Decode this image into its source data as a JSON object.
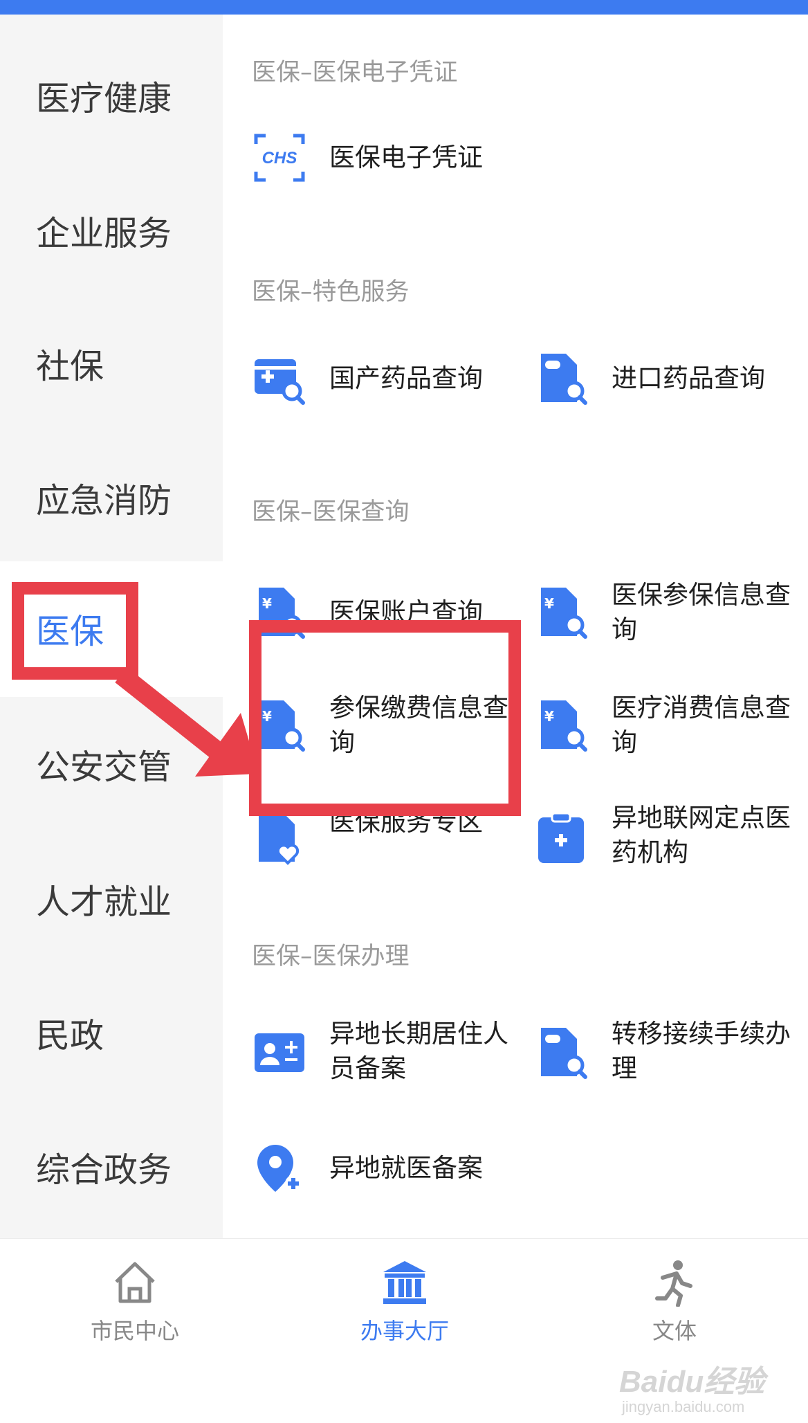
{
  "sidebar": {
    "items": [
      {
        "label": "医疗健康"
      },
      {
        "label": "企业服务"
      },
      {
        "label": "社保"
      },
      {
        "label": "应急消防"
      },
      {
        "label": "医保",
        "active": true
      },
      {
        "label": "公安交管"
      },
      {
        "label": "人才就业"
      },
      {
        "label": "民政"
      },
      {
        "label": "综合政务"
      }
    ]
  },
  "sections": [
    {
      "title": "医保–医保电子凭证",
      "items": [
        {
          "label": "医保电子凭证",
          "icon": "chs-card-icon"
        }
      ]
    },
    {
      "title": "医保–特色服务",
      "items": [
        {
          "label": "国产药品查询",
          "icon": "medicine-box-search-icon"
        },
        {
          "label": "进口药品查询",
          "icon": "pill-document-search-icon"
        }
      ]
    },
    {
      "title": "医保–医保查询",
      "items": [
        {
          "label": "医保账户查询",
          "icon": "yuan-document-search-icon"
        },
        {
          "label": "医保参保信息查\n询",
          "icon": "yuan-document-search-icon"
        },
        {
          "label": "参保缴费信息查\n询",
          "icon": "yuan-document-search-icon"
        },
        {
          "label": "医疗消费信息查\n询",
          "icon": "yuan-document-search-icon"
        },
        {
          "label": "医保服务专区",
          "icon": "heart-document-icon"
        },
        {
          "label": "异地联网定点医\n药机构",
          "icon": "medical-clipboard-icon"
        }
      ]
    },
    {
      "title": "医保–医保办理",
      "items": [
        {
          "label": "异地长期居住人\n员备案",
          "icon": "id-card-icon"
        },
        {
          "label": "转移接续手续办\n理",
          "icon": "pill-document-search-icon"
        },
        {
          "label": "异地就医备案",
          "icon": "location-add-icon"
        }
      ]
    }
  ],
  "bottom_nav": {
    "tabs": [
      {
        "label": "市民中心",
        "icon": "home-icon"
      },
      {
        "label": "办事大厅",
        "icon": "hall-building-icon",
        "active": true
      },
      {
        "label": "文体",
        "icon": "runner-icon"
      }
    ]
  },
  "watermark": {
    "brand": "Baidu经验",
    "url": "jingyan.baidu.com"
  },
  "colors": {
    "accent": "#3d7bf0",
    "highlight": "#e8404a"
  }
}
